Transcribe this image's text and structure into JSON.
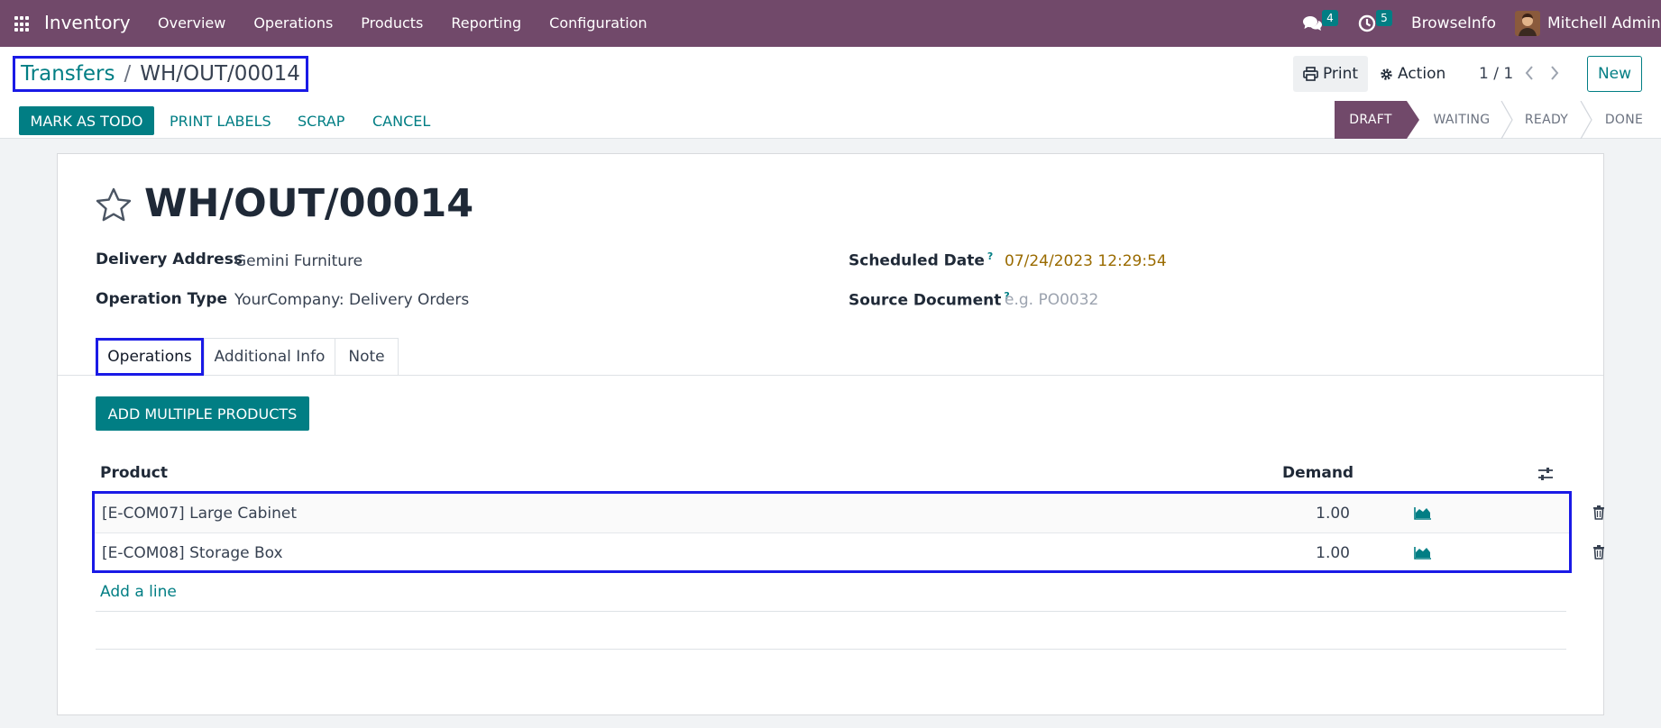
{
  "navbar": {
    "app_name": "Inventory",
    "menu": [
      "Overview",
      "Operations",
      "Products",
      "Reporting",
      "Configuration"
    ],
    "messages_count": "4",
    "activities_count": "5",
    "company": "BrowseInfo",
    "user": "Mitchell Admin",
    "bg_color": "#71496a"
  },
  "breadcrumb": {
    "parent": "Transfers",
    "separator": "/",
    "current": "WH/OUT/00014"
  },
  "toolbar": {
    "print_label": "Print",
    "action_label": "Action",
    "pager": "1 / 1",
    "new_label": "New",
    "prev_icon": "chevron-left-icon",
    "next_icon": "chevron-right-icon"
  },
  "buttons": {
    "mark_todo": "MARK AS TODO",
    "print_labels": "PRINT LABELS",
    "scrap": "SCRAP",
    "cancel": "CANCEL"
  },
  "statusbar": {
    "steps": [
      "DRAFT",
      "WAITING",
      "READY",
      "DONE"
    ],
    "active": "DRAFT"
  },
  "record": {
    "title": "WH/OUT/00014",
    "fields": {
      "delivery_address_label": "Delivery Address",
      "delivery_address": "Gemini Furniture",
      "operation_type_label": "Operation Type",
      "operation_type": "YourCompany: Delivery Orders",
      "scheduled_date_label": "Scheduled Date",
      "scheduled_date": "07/24/2023 12:29:54",
      "source_document_label": "Source Document",
      "source_document_placeholder": "e.g. PO0032",
      "help_mark": "?"
    }
  },
  "tabs": [
    "Operations",
    "Additional Info",
    "Note"
  ],
  "operations": {
    "add_multiple_label": "ADD MULTIPLE PRODUCTS",
    "columns": {
      "product": "Product",
      "demand": "Demand"
    },
    "rows": [
      {
        "product": "[E-COM07] Large Cabinet",
        "demand": "1.00"
      },
      {
        "product": "[E-COM08] Storage Box",
        "demand": "1.00"
      }
    ],
    "add_line": "Add a line"
  },
  "colors": {
    "accent": "#017e84",
    "brand": "#71496a",
    "highlight_box": "#1a1ae6",
    "date_color": "#9a6b00"
  }
}
